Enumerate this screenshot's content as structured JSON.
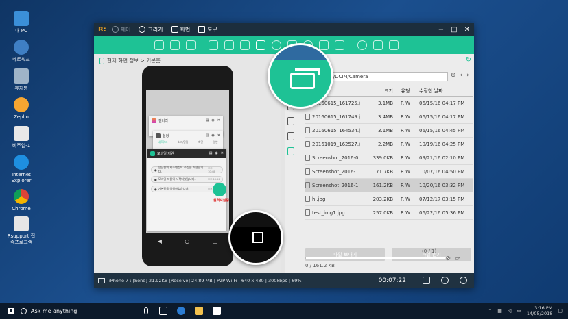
{
  "desktop": {
    "icons": [
      {
        "label": "내 PC"
      },
      {
        "label": "네트워크"
      },
      {
        "label": "휴지통"
      },
      {
        "label": "Zeplin"
      },
      {
        "label": "비주얼-1"
      },
      {
        "label": "Internet Explorer"
      },
      {
        "label": "Chrome"
      },
      {
        "label": "Rsupport 접속프로그램"
      }
    ]
  },
  "window": {
    "logo": "R:",
    "menus": [
      "제어",
      "그리기",
      "화면",
      "도구"
    ],
    "controls": {
      "minimize": "−",
      "maximize": "□",
      "close": "✕"
    }
  },
  "left": {
    "breadcrumb": "현재 화면 정보 > 기본홈",
    "phone": {
      "cards": {
        "gallery": "갤러리",
        "settings": "설정",
        "settings_tabs": [
          "네트워크",
          "소리/알림",
          "화면",
          "일반"
        ],
        "mobile": "모바일 지원",
        "messages": [
          {
            "text": "상담원의 시스템정보 수집을 허용합니다.",
            "time": "오후 10:48"
          },
          {
            "text": "모바일 지원이 시작되었습니다.",
            "time": "오후 10:48"
          },
          {
            "text": "기본홈을 실행하였습니다.",
            "time": "오후 10:48"
          }
        ],
        "remote_label": "원격지원중"
      },
      "nav": {
        "back": "◀",
        "home": "○",
        "recent": "□"
      }
    }
  },
  "right": {
    "path": "mulated/0/DCIM/Camera",
    "columns": [
      "크기",
      "유형",
      "수정한 날짜"
    ],
    "files": [
      {
        "name": "20160615_161725.j",
        "size": "3.1MB",
        "type": "R W",
        "date": "06/15/16 04:17 PM"
      },
      {
        "name": "20160615_161749.j",
        "size": "3.4MB",
        "type": "R W",
        "date": "06/15/16 04:17 PM"
      },
      {
        "name": "20160615_164534.j",
        "size": "3.1MB",
        "type": "R W",
        "date": "06/15/16 04:45 PM"
      },
      {
        "name": "20161019_162527.j",
        "size": "2.2MB",
        "type": "R W",
        "date": "10/19/16 04:25 PM"
      },
      {
        "name": "Screenshot_2016-0",
        "size": "339.0KB",
        "type": "R W",
        "date": "09/21/16 02:10 PM"
      },
      {
        "name": "Screenshot_2016-1",
        "size": "71.7KB",
        "type": "R W",
        "date": "10/07/16 04:50 PM"
      },
      {
        "name": "Screenshot_2016-1",
        "size": "161.2KB",
        "type": "R W",
        "date": "10/20/16 03:32 PM",
        "selected": true
      },
      {
        "name": "hi.jpg",
        "size": "203.2KB",
        "type": "R W",
        "date": "07/12/17 03:15 PM"
      },
      {
        "name": "test_img1.jpg",
        "size": "257.0KB",
        "type": "R W",
        "date": "06/22/16 05:36 PM"
      }
    ],
    "send_button": "파일 보내기",
    "receive_button": "파일 받기",
    "progress_label": "(0 / 1)",
    "progress_value": 0,
    "transfer": "0 / 161.2 KB"
  },
  "status": {
    "info": "iPhone 7 : [Send] 21.92KB  [Receive] 24.89 MB | P2P Wi-Fi | 640 x 480 | 300kbps | 69%",
    "timer": "00:07:22"
  },
  "taskbar": {
    "search": "Ask me anything",
    "time": "3:16 PM",
    "date": "14/05/2018"
  },
  "colors": {
    "accent": "#1ec295",
    "titlebar": "#1c2e3d"
  }
}
